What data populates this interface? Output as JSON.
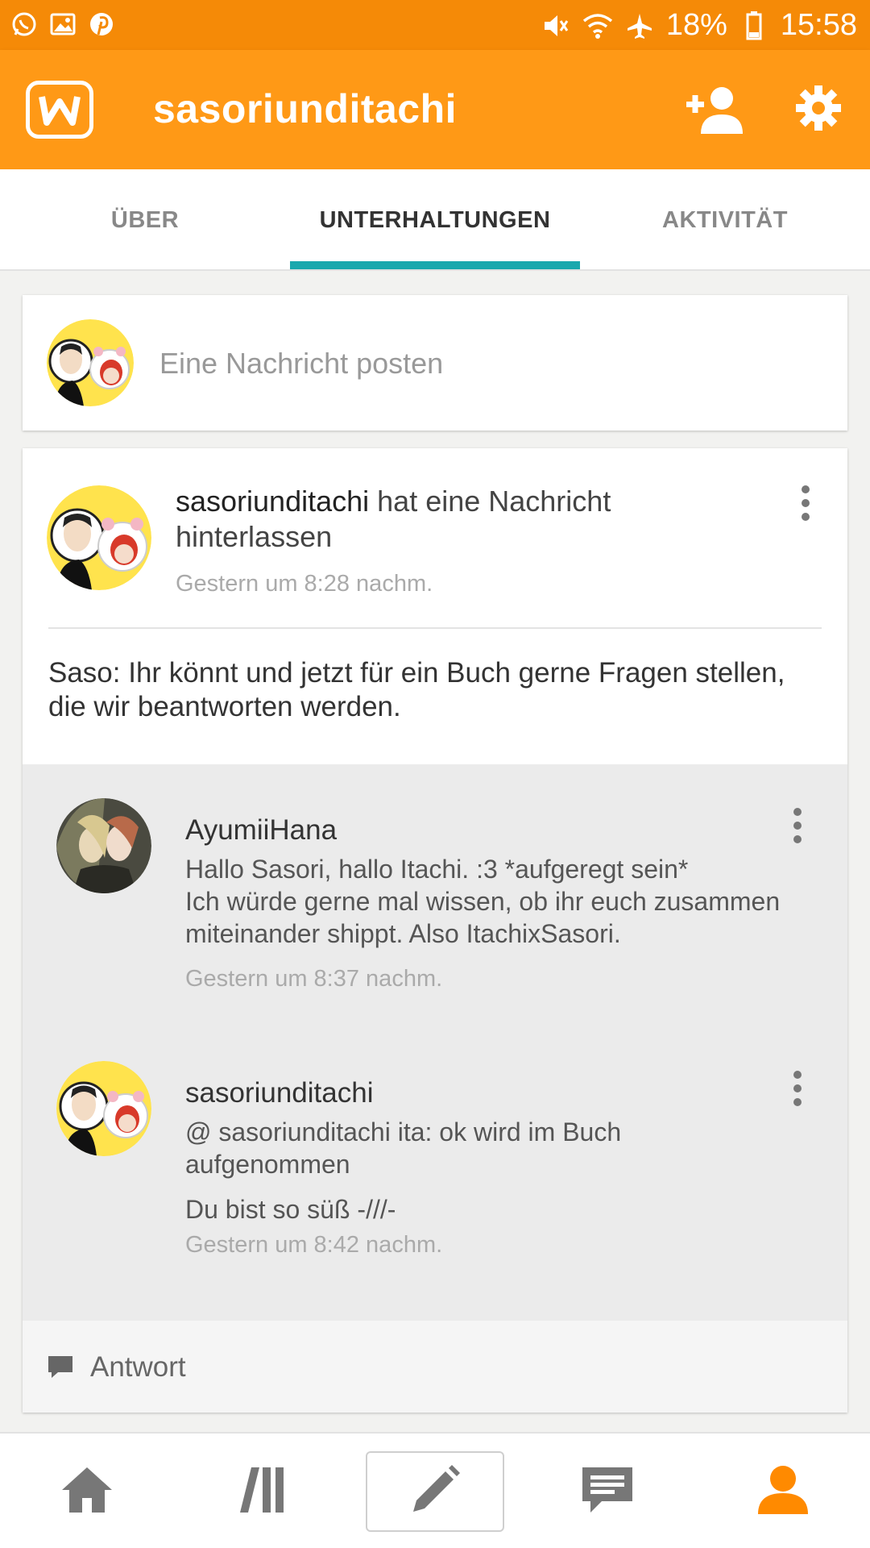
{
  "statusbar": {
    "notifications": [
      "whatsapp-icon",
      "gallery-icon",
      "pinterest-icon"
    ],
    "battery": "18%",
    "time": "15:58"
  },
  "appbar": {
    "title": "sasoriunditachi",
    "logo_letter": "w"
  },
  "tabs": [
    {
      "label": "ÜBER",
      "active": false
    },
    {
      "label": "UNTERHALTUNGEN",
      "active": true
    },
    {
      "label": "AKTIVITÄT",
      "active": false
    }
  ],
  "compose": {
    "placeholder": "Eine Nachricht posten"
  },
  "thread": {
    "author": "sasoriunditachi",
    "action": "hat eine Nachricht hinterlassen",
    "time": "Gestern um 8:28 nachm.",
    "message": "Saso: Ihr könnt und jetzt für ein Buch gerne Fragen stellen, die wir beantworten werden.",
    "replies": [
      {
        "author": "AyumiiHana",
        "body": "Hallo Sasori, hallo Itachi. :3 *aufgeregt sein*\nIch würde gerne mal wissen, ob ihr euch zusammen miteinander shippt. Also ItachixSasori.",
        "time": "Gestern um 8:37 nachm."
      },
      {
        "author": "sasoriunditachi",
        "body": "@ sasoriunditachi  ita: ok wird im Buch aufgenommen",
        "body2": "Du bist so süß -///-",
        "time": "Gestern um 8:42 nachm."
      }
    ],
    "reply_label": "Antwort"
  },
  "bottomnav": {
    "items": [
      "home-icon",
      "library-icon",
      "write-icon",
      "messages-icon",
      "profile-icon"
    ],
    "active": "profile-icon"
  },
  "colors": {
    "statusbar": "#f58a07",
    "appbar": "#ff9916",
    "tab_indicator": "#1aa8ad",
    "accent": "#ff8a00"
  }
}
